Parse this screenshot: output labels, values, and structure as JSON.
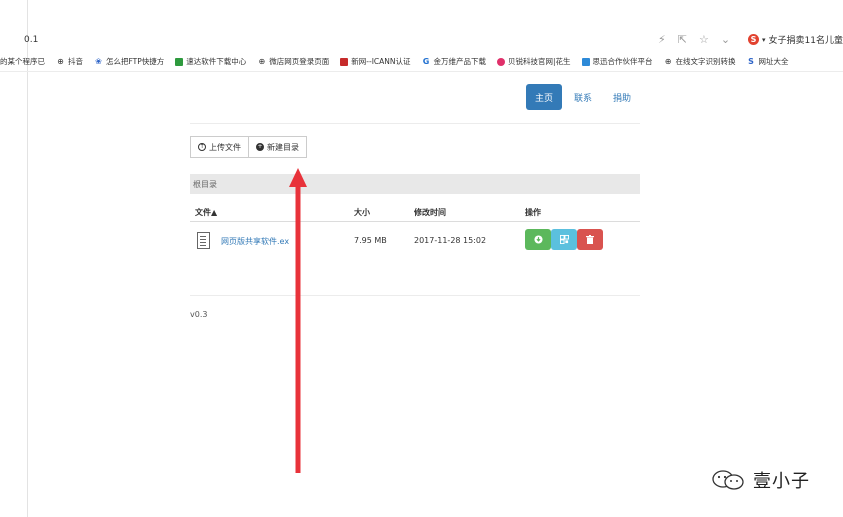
{
  "browser": {
    "url_fragment": "0.1",
    "search_text": "女子捐卖11名儿童",
    "bookmarks": [
      {
        "label": "的某个程序已",
        "icon": "none"
      },
      {
        "label": "抖音",
        "icon": "globe-icon"
      },
      {
        "label": "怎么把FTP快捷方",
        "icon": "paw-icon"
      },
      {
        "label": "速达软件下载中心",
        "icon": "green-square-icon"
      },
      {
        "label": "微店网页登录页面",
        "icon": "globe-icon"
      },
      {
        "label": "新网--ICANN认证",
        "icon": "red-square-icon"
      },
      {
        "label": "金万维产品下载",
        "icon": "g-icon"
      },
      {
        "label": "贝锐科技官网|花生",
        "icon": "pink-circle-icon"
      },
      {
        "label": "思迅合作伙伴平台",
        "icon": "blue-square-icon"
      },
      {
        "label": "在线文字识别转换",
        "icon": "globe-icon"
      },
      {
        "label": "网址大全",
        "icon": "blue-s-icon"
      }
    ]
  },
  "nav": {
    "home": "主页",
    "contact": "联系",
    "donate": "捐助"
  },
  "toolbar": {
    "upload": "上传文件",
    "new_dir": "新建目录"
  },
  "breadcrumb": "根目录",
  "table": {
    "headers": {
      "file": "文件",
      "size": "大小",
      "modified": "修改时间",
      "ops": "操作"
    },
    "rows": [
      {
        "name": "网页版共享软件.ex",
        "size": "7.95 MB",
        "modified": "2017-11-28 15:02"
      }
    ]
  },
  "version": "v0.3",
  "watermark": "壹小子",
  "colors": {
    "primary": "#337ab7",
    "success": "#5cb85c",
    "info": "#5bc0de",
    "danger": "#d9534f",
    "annotation_arrow": "#e8323a"
  }
}
